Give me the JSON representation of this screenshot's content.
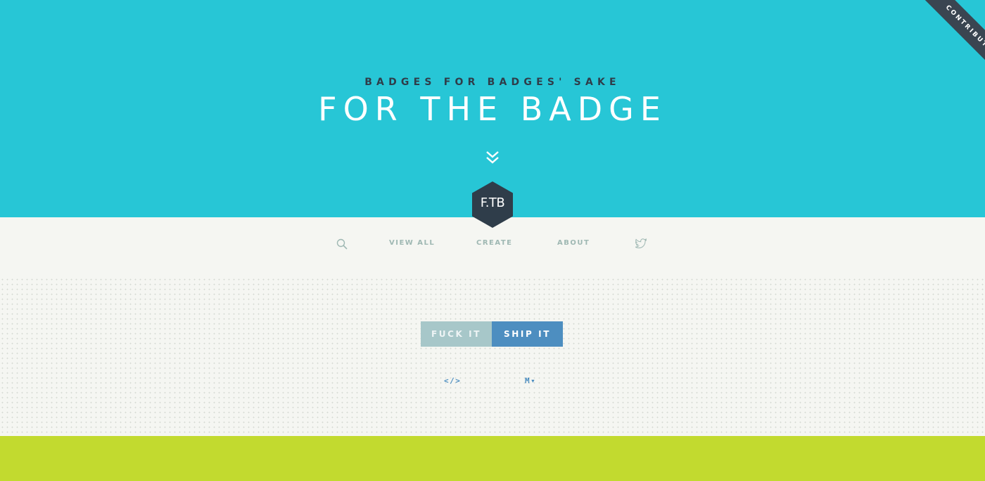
{
  "hero": {
    "kicker": "BADGES FOR BADGES' SAKE",
    "title": "FOR THE BADGE",
    "contribute_label": "CONTRIBUTE"
  },
  "logo": {
    "text": "F.TB"
  },
  "nav": {
    "items": [
      {
        "label": "VIEW ALL"
      },
      {
        "label": "CREATE"
      },
      {
        "label": "ABOUT"
      }
    ],
    "search_icon": "search-icon",
    "twitter_icon": "twitter-icon"
  },
  "badge": {
    "left_text": "FUCK IT",
    "right_text": "SHIP IT"
  },
  "embed": {
    "html_label": "</>",
    "markdown_label": "M▾"
  },
  "colors": {
    "hero": "#27c6d6",
    "dark": "#2f3d4a",
    "nav_text": "#9fb8b3",
    "badge_left": "#a7c7c9",
    "badge_right": "#4d8ec0",
    "footer": "#c2da2f"
  }
}
